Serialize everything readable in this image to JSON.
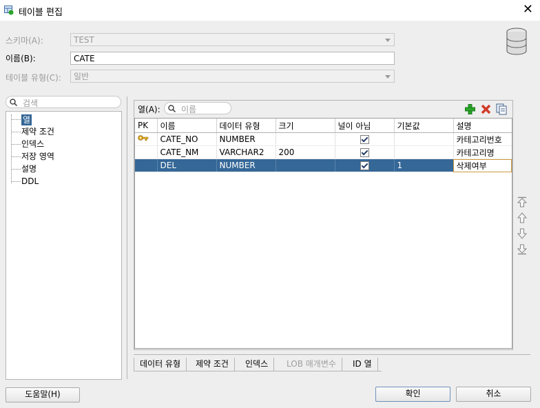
{
  "window": {
    "title": "테이블 편집",
    "close_glyph": "✕"
  },
  "form": {
    "schema_label": "스키마(A):",
    "schema_value": "TEST",
    "name_label": "이름(B):",
    "name_value": "CATE",
    "type_label": "테이블 유형(C):",
    "type_value": "일반"
  },
  "nav": {
    "search_placeholder": "검색",
    "items": [
      {
        "label": "열",
        "selected": true
      },
      {
        "label": "제약 조건"
      },
      {
        "label": "인덱스"
      },
      {
        "label": "저장 영역"
      },
      {
        "label": "설명"
      },
      {
        "label": "DDL"
      }
    ]
  },
  "columns_panel": {
    "label": "열(A):",
    "filter_placeholder": "이름",
    "toolbar": {
      "add_icon": "plus-icon",
      "delete_icon": "delete-x-icon",
      "copy_icon": "copy-icon"
    },
    "headers": [
      "PK",
      "이름",
      "데이터 유형",
      "크기",
      "널이 아님",
      "기본값",
      "설명"
    ],
    "rows": [
      {
        "pk": true,
        "name": "CATE_NO",
        "type": "NUMBER",
        "size": "",
        "not_null": true,
        "default": "",
        "comment": "카테고리번호",
        "selected": false
      },
      {
        "pk": false,
        "name": "CATE_NM",
        "type": "VARCHAR2",
        "size": "200",
        "not_null": true,
        "default": "",
        "comment": "카테고리명",
        "selected": false
      },
      {
        "pk": false,
        "name": "DEL",
        "type": "NUMBER",
        "size": "",
        "not_null": true,
        "default": "1",
        "comment": "삭제여부",
        "selected": true
      }
    ]
  },
  "bottom_tabs": [
    {
      "label": "데이터 유형",
      "disabled": false
    },
    {
      "label": "제약 조건",
      "disabled": false
    },
    {
      "label": "인덱스",
      "disabled": false
    },
    {
      "label": "LOB 매개변수",
      "disabled": true
    },
    {
      "label": "ID 열",
      "disabled": false
    }
  ],
  "buttons": {
    "help": "도움말(H)",
    "ok": "확인",
    "cancel": "취소"
  },
  "colors": {
    "selection": "#356797",
    "add": "#2aa52a",
    "delete": "#d23a2a"
  }
}
